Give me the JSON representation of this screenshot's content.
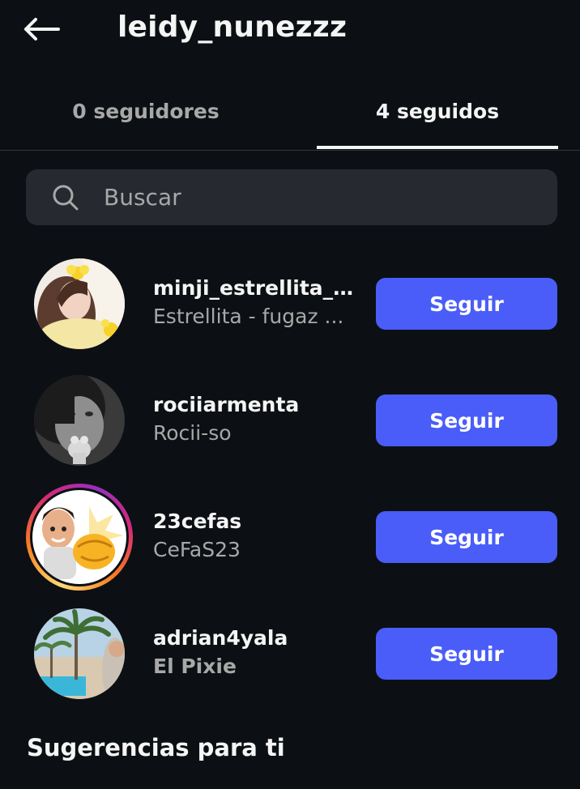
{
  "header": {
    "title": "leidy_nunezzz"
  },
  "tabs": [
    {
      "label": "0 seguidores",
      "active": false
    },
    {
      "label": "4 seguidos",
      "active": true
    }
  ],
  "search": {
    "placeholder": "Buscar"
  },
  "users": [
    {
      "username": "minji_estrellita_fu...",
      "name": "Estrellita - fugaz ...",
      "button": "Seguir",
      "avatar": "photo-girl-yellow-flower",
      "story_ring": false
    },
    {
      "username": "rociiarmenta",
      "name": "Rocii-so",
      "button": "Seguir",
      "avatar": "photo-bw-hello-kitty",
      "story_ring": false
    },
    {
      "username": "23cefas",
      "name": "CeFaS23",
      "button": "Seguir",
      "avatar": "avatar-cartoon-fist",
      "story_ring": true
    },
    {
      "username": "adrian4yala",
      "name": "El Pixie",
      "button": "Seguir",
      "avatar": "photo-palm-trees-pool",
      "story_ring": false
    }
  ],
  "suggestions": {
    "heading": "Sugerencias para ti"
  },
  "colors": {
    "background": "#0c1014",
    "follow_button": "#4a5df9",
    "search_bg": "#262a30",
    "secondary_text": "#a8a8a8"
  }
}
